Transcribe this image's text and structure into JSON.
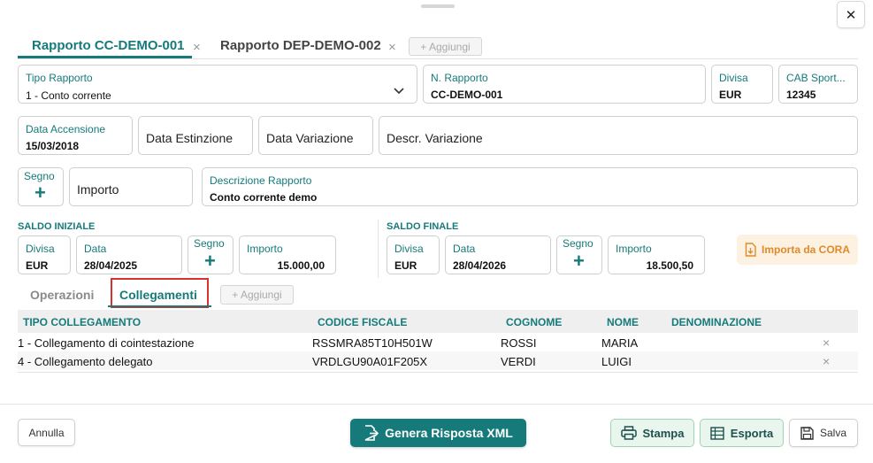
{
  "tabs": [
    {
      "label": "Rapporto CC-DEMO-001",
      "active": true
    },
    {
      "label": "Rapporto DEP-DEMO-002",
      "active": false
    }
  ],
  "tabs_add_label": "+ Aggiungi",
  "tab_close_glyph": "×",
  "close_glyph": "✕",
  "form": {
    "tipo_rapporto": {
      "label": "Tipo Rapporto",
      "value": "1 - Conto corrente"
    },
    "n_rapporto": {
      "label": "N. Rapporto",
      "value": "CC-DEMO-001"
    },
    "divisa": {
      "label": "Divisa",
      "value": "EUR"
    },
    "cab": {
      "label": "CAB Sport...",
      "value": "12345"
    },
    "data_accensione": {
      "label": "Data Accensione",
      "value": "15/03/2018"
    },
    "data_estinzione": {
      "label": "Data Estinzione"
    },
    "data_variazione": {
      "label": "Data Variazione"
    },
    "descr_variazione": {
      "label": "Descr. Variazione"
    },
    "segno": {
      "label": "Segno",
      "value": "+"
    },
    "importo": {
      "label": "Importo"
    },
    "descrizione_rapporto": {
      "label": "Descrizione Rapporto",
      "value": "Conto corrente demo"
    }
  },
  "saldo_iniziale": {
    "title": "SALDO INIZIALE",
    "divisa_label": "Divisa",
    "divisa": "EUR",
    "data_label": "Data",
    "data": "28/04/2025",
    "segno_label": "Segno",
    "segno": "+",
    "importo_label": "Importo",
    "importo": "15.000,00"
  },
  "saldo_finale": {
    "title": "SALDO FINALE",
    "divisa_label": "Divisa",
    "divisa": "EUR",
    "data_label": "Data",
    "data": "28/04/2026",
    "segno_label": "Segno",
    "segno": "+",
    "importo_label": "Importo",
    "importo": "18.500,50"
  },
  "import_cora_label": "Importa da CORA",
  "subtabs": [
    {
      "label": "Operazioni",
      "active": false
    },
    {
      "label": "Collegamenti",
      "active": true
    }
  ],
  "subtabs_add_label": "+ Aggiungi",
  "table": {
    "headers": [
      "TIPO COLLEGAMENTO",
      "CODICE FISCALE",
      "COGNOME",
      "NOME",
      "DENOMINAZIONE"
    ],
    "rows": [
      [
        "1 - Collegamento di cointestazione",
        "RSSMRA85T10H501W",
        "ROSSI",
        "MARIA",
        ""
      ],
      [
        "4 - Collegamento delegato",
        "VRDLGU90A01F205X",
        "VERDI",
        "LUIGI",
        ""
      ]
    ],
    "delete_glyph": "×"
  },
  "footer": {
    "annulla": "Annulla",
    "genera": "Genera Risposta XML",
    "stampa": "Stampa",
    "esporta": "Esporta",
    "salva": "Salva"
  },
  "colors": {
    "accent": "#167a7a",
    "highlight": "#d93030",
    "orange": "#e08a2a"
  }
}
